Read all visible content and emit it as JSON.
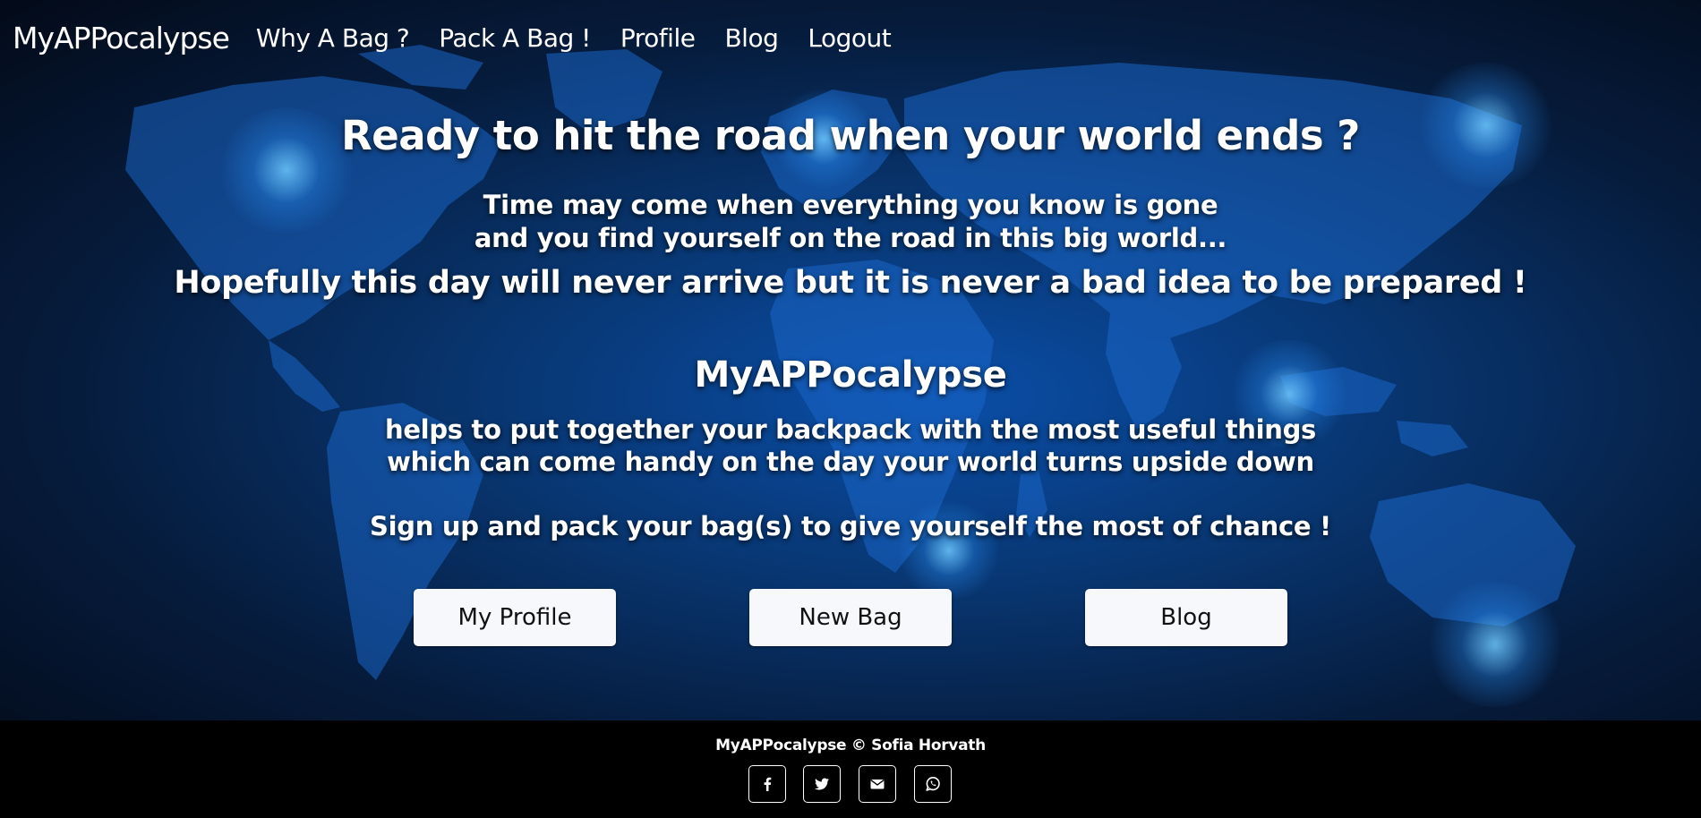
{
  "nav": {
    "brand": "MyAPPocalypse",
    "links": [
      "Why A Bag ?",
      "Pack A Bag !",
      "Profile",
      "Blog",
      "Logout"
    ]
  },
  "hero": {
    "headline": "Ready to hit the road when your world ends ?",
    "line1": "Time may come when everything you know is gone",
    "line2": "and you find yourself on the road in this big world...",
    "line3": "Hopefully this day will never arrive but it is never a bad idea to be prepared !",
    "app_name": "MyAPPocalypse",
    "desc1": "helps to put together your backpack with the most useful things",
    "desc2": "which can come handy on the day your world turns upside down",
    "cta": "Sign up and pack your bag(s) to give yourself the most of chance !"
  },
  "buttons": {
    "profile": "My Profile",
    "new_bag": "New Bag",
    "blog": "Blog"
  },
  "footer": {
    "copyright": "MyAPPocalypse © Sofia Horvath",
    "social_icons": [
      "facebook-icon",
      "twitter-icon",
      "email-icon",
      "whatsapp-icon"
    ]
  }
}
